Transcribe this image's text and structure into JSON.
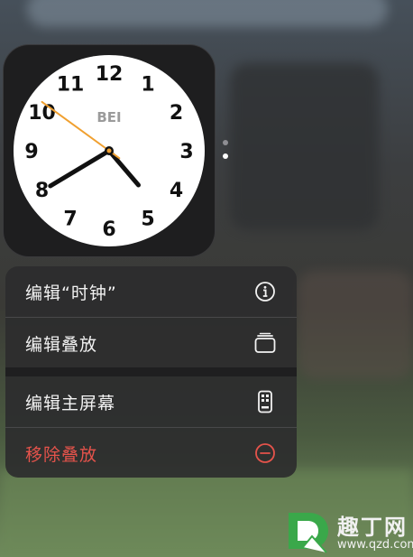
{
  "clock_widget": {
    "city": "BEI",
    "numerals": [
      "12",
      "1",
      "2",
      "3",
      "4",
      "5",
      "6",
      "7",
      "8",
      "9",
      "10",
      "11"
    ],
    "time": {
      "hour": 4,
      "minute": 39,
      "second": 51
    },
    "colors": {
      "face": "#ffffff",
      "hands": "#111111",
      "second_hand": "#f0a030"
    }
  },
  "page_dots": {
    "count": 2,
    "active_index": 1
  },
  "context_menu": {
    "items": [
      {
        "label": "编辑“时钟”",
        "icon": "info-circle-icon",
        "destructive": false
      },
      {
        "label": "编辑叠放",
        "icon": "stack-icon",
        "destructive": false
      },
      {
        "label": "编辑主屏幕",
        "icon": "phone-screen-icon",
        "destructive": false
      },
      {
        "label": "移除叠放",
        "icon": "minus-circle-icon",
        "destructive": true
      }
    ],
    "colors": {
      "destructive": "#e5534b"
    }
  },
  "watermark": {
    "brand": "趣丁网",
    "url": "www.qzd.com"
  }
}
